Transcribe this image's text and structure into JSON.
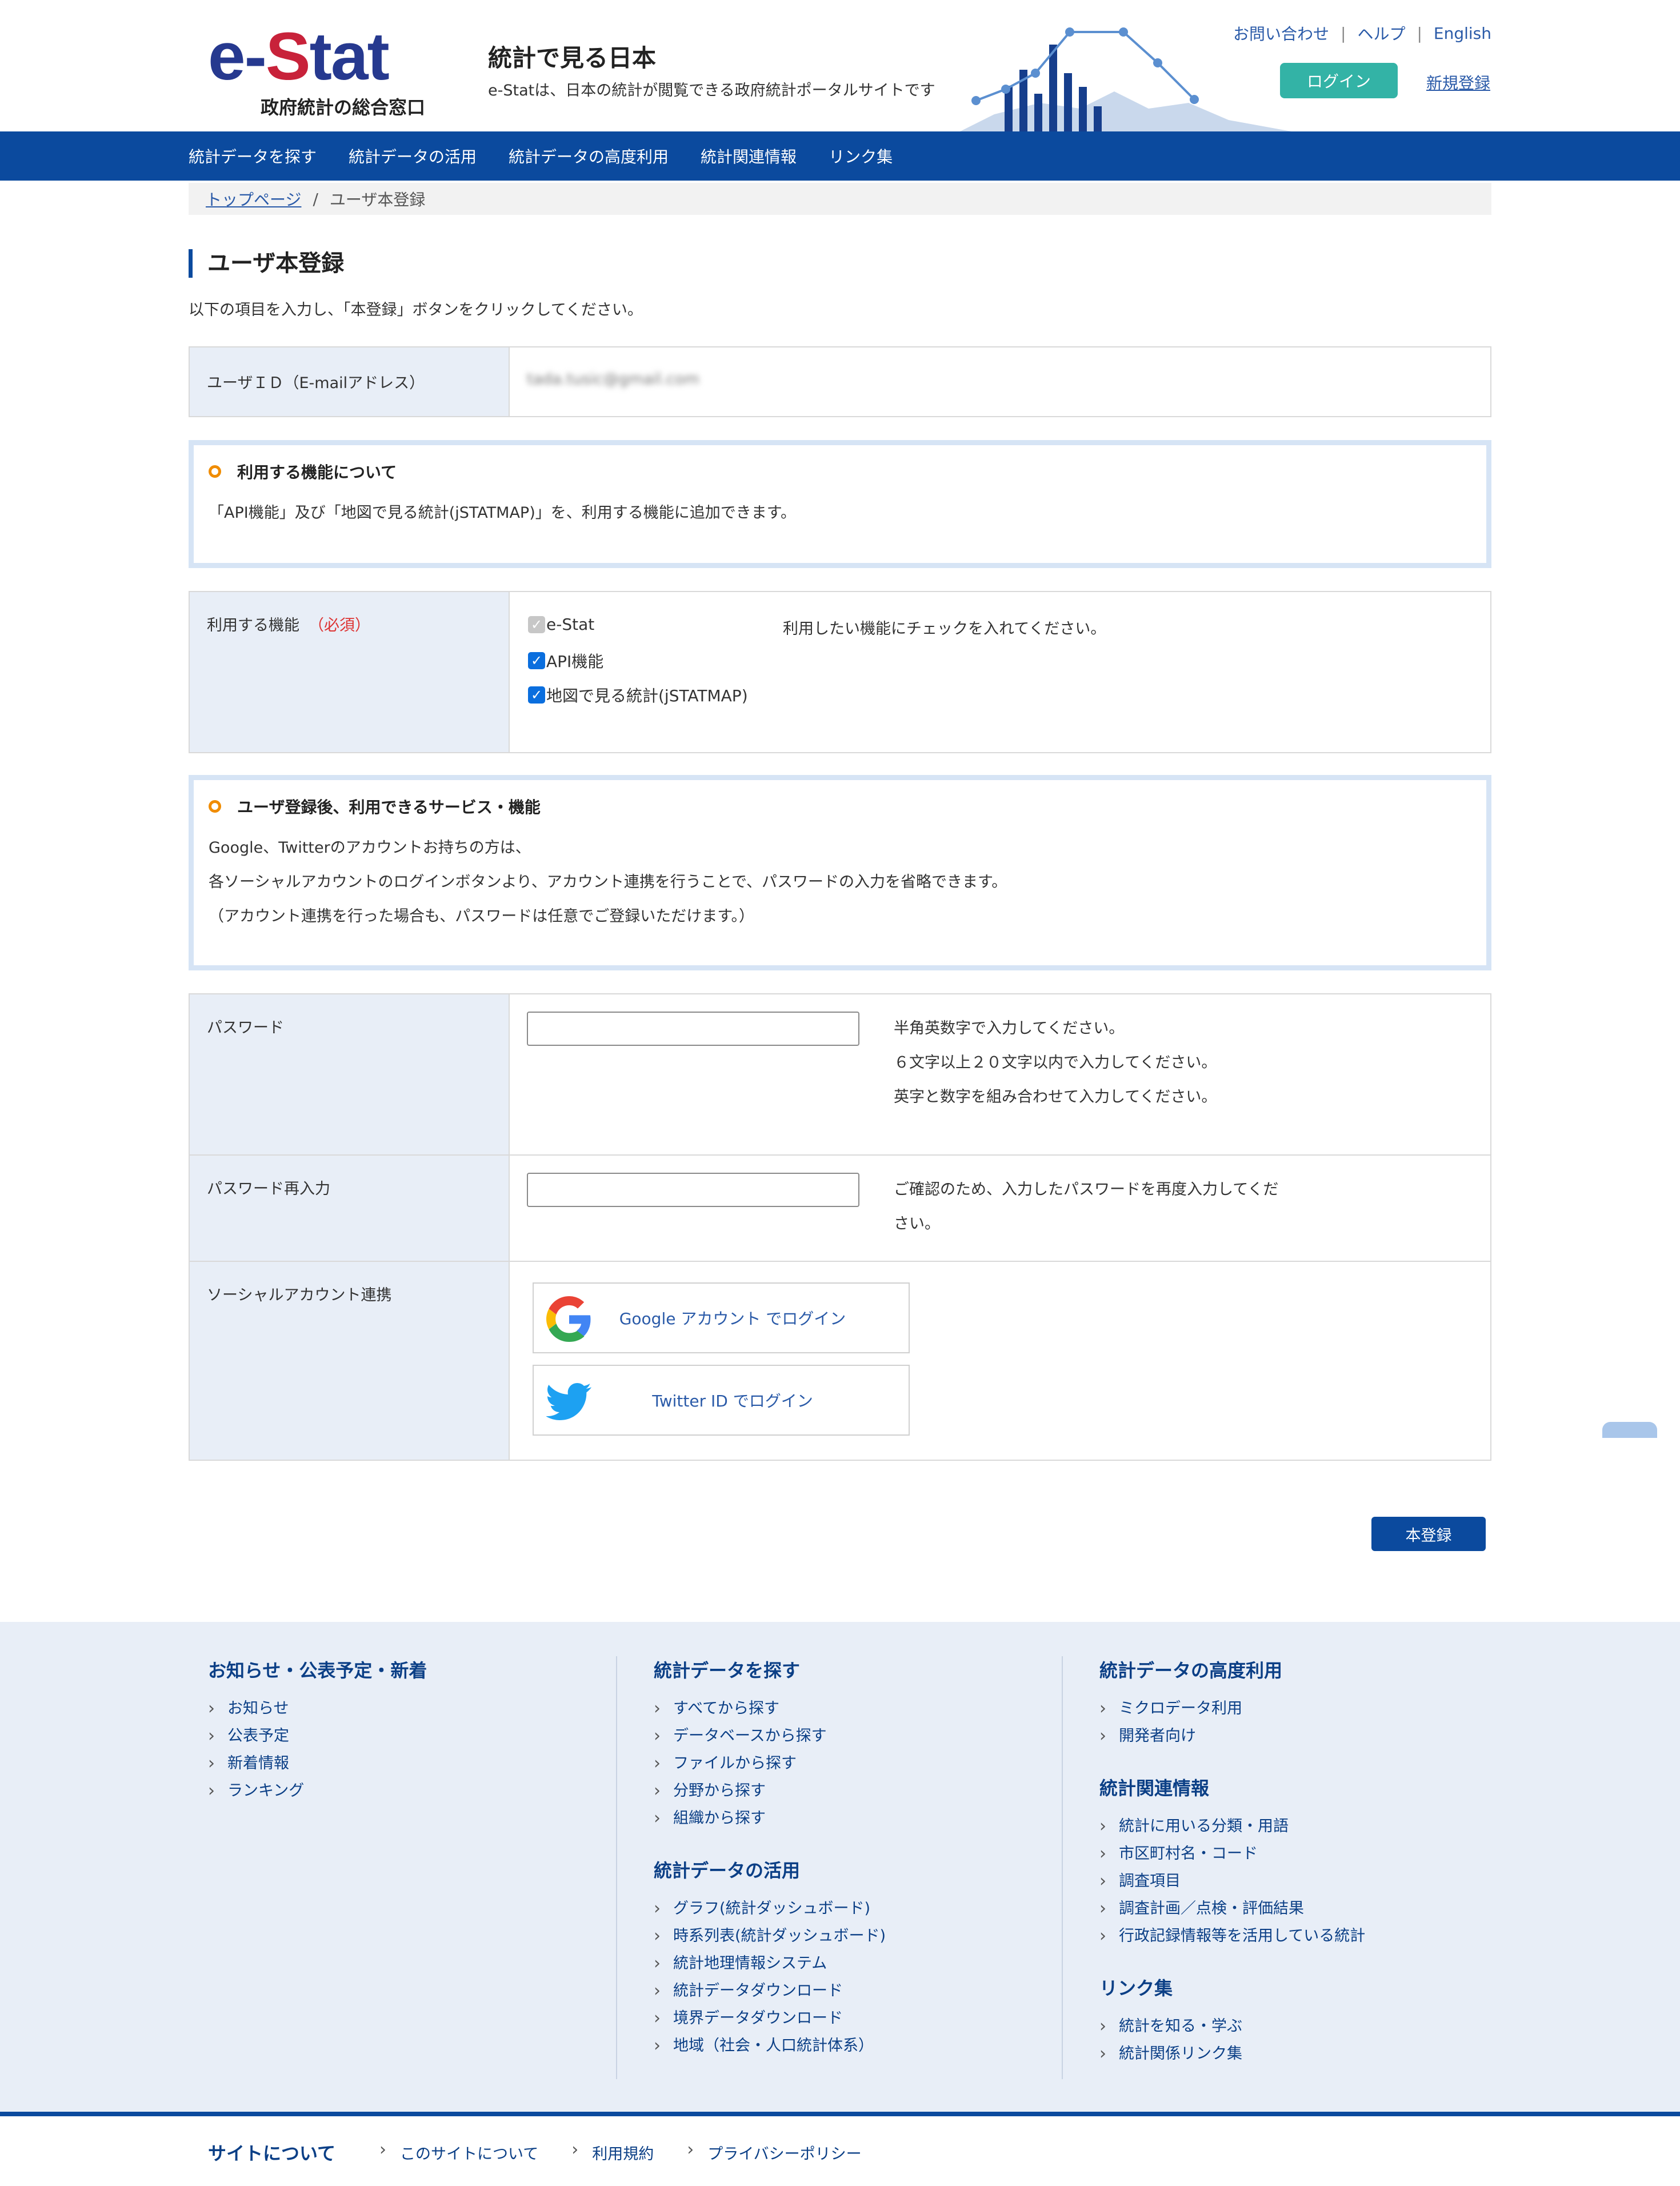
{
  "header": {
    "logo_part1": "e-",
    "logo_part2": "S",
    "logo_part3": "tat",
    "logo_sub": "政府統計の総合窓口",
    "site_title": "統計で見る日本",
    "site_desc": "e-Statは、日本の統計が閲覧できる政府統計ポータルサイトです",
    "top_links": [
      "お問い合わせ",
      "ヘルプ",
      "English"
    ],
    "separator": "|",
    "login_label": "ログイン",
    "register_label": "新規登録"
  },
  "nav": {
    "items": [
      "統計データを探す",
      "統計データの活用",
      "統計データの高度利用",
      "統計関連情報",
      "リンク集"
    ]
  },
  "breadcrumb": {
    "home": "トップページ",
    "separator": "/",
    "current": "ユーザ本登録"
  },
  "page": {
    "title": "ユーザ本登録",
    "intro": "以下の項目を入力し、「本登録」ボタンをクリックしてください。"
  },
  "userid": {
    "label": "ユーザＩＤ（E-mailアドレス）",
    "value": "tada.tusic@gmail.com"
  },
  "feature_info": {
    "heading": "利用する機能について",
    "text": "「API機能」及び「地図で見る統計(jSTATMAP)」を、利用する機能に追加できます。"
  },
  "features": {
    "label": "利用する機能",
    "required": "（必須）",
    "options": [
      {
        "label": "e-Stat",
        "checked": true,
        "disabled": true
      },
      {
        "label": "API機能",
        "checked": true,
        "disabled": false
      },
      {
        "label": "地図で見る統計(jSTATMAP)",
        "checked": true,
        "disabled": false
      }
    ],
    "hint": "利用したい機能にチェックを入れてください。"
  },
  "service_info": {
    "heading": "ユーザ登録後、利用できるサービス・機能",
    "lines": [
      "Google、Twitterのアカウントお持ちの方は、",
      "各ソーシャルアカウントのログインボタンより、アカウント連携を行うことで、パスワードの入力を省略できます。",
      "（アカウント連携を行った場合も、パスワードは任意でご登録いただけます。）"
    ]
  },
  "password": {
    "label": "パスワード",
    "value": "",
    "hints": [
      "半角英数字で入力してください。",
      "６文字以上２０文字以内で入力してください。",
      "英字と数字を組み合わせて入力してください。"
    ]
  },
  "password_confirm": {
    "label": "パスワード再入力",
    "value": "",
    "hints": [
      "ご確認のため、入力したパスワードを再度入力してくだ",
      "さい。"
    ]
  },
  "social": {
    "label": "ソーシャルアカウント連携",
    "google_label": "Google アカウント でログイン",
    "twitter_label": "Twitter ID でログイン"
  },
  "submit_label": "本登録",
  "footer": {
    "col1": [
      {
        "heading": "お知らせ・公表予定・新着",
        "items": [
          "お知らせ",
          "公表予定",
          "新着情報",
          "ランキング"
        ]
      }
    ],
    "col2": [
      {
        "heading": "統計データを探す",
        "items": [
          "すべてから探す",
          "データベースから探す",
          "ファイルから探す",
          "分野から探す",
          "組織から探す"
        ]
      },
      {
        "heading": "統計データの活用",
        "items": [
          "グラフ(統計ダッシュボード)",
          "時系列表(統計ダッシュボード)",
          "統計地理情報システム",
          "統計データダウンロード",
          "境界データダウンロード",
          "地域（社会・人口統計体系）"
        ]
      }
    ],
    "col3": [
      {
        "heading": "統計データの高度利用",
        "items": [
          "ミクロデータ利用",
          "開発者向け"
        ]
      },
      {
        "heading": "統計関連情報",
        "items": [
          "統計に用いる分類・用語",
          "市区町村名・コード",
          "調査項目",
          "調査計画／点検・評価結果",
          "行政記録情報等を活用している統計"
        ]
      },
      {
        "heading": "リンク集",
        "items": [
          "統計を知る・学ぶ",
          "統計関係リンク集"
        ]
      }
    ],
    "bottom_title": "サイトについて",
    "bottom_links": [
      "このサイトについて",
      "利用規約",
      "プライバシーポリシー"
    ]
  },
  "colors": {
    "brand_blue": "#0b4a9e",
    "logo_red": "#c8223a",
    "login_teal": "#33b3a6",
    "accent_orange": "#f08c00"
  }
}
